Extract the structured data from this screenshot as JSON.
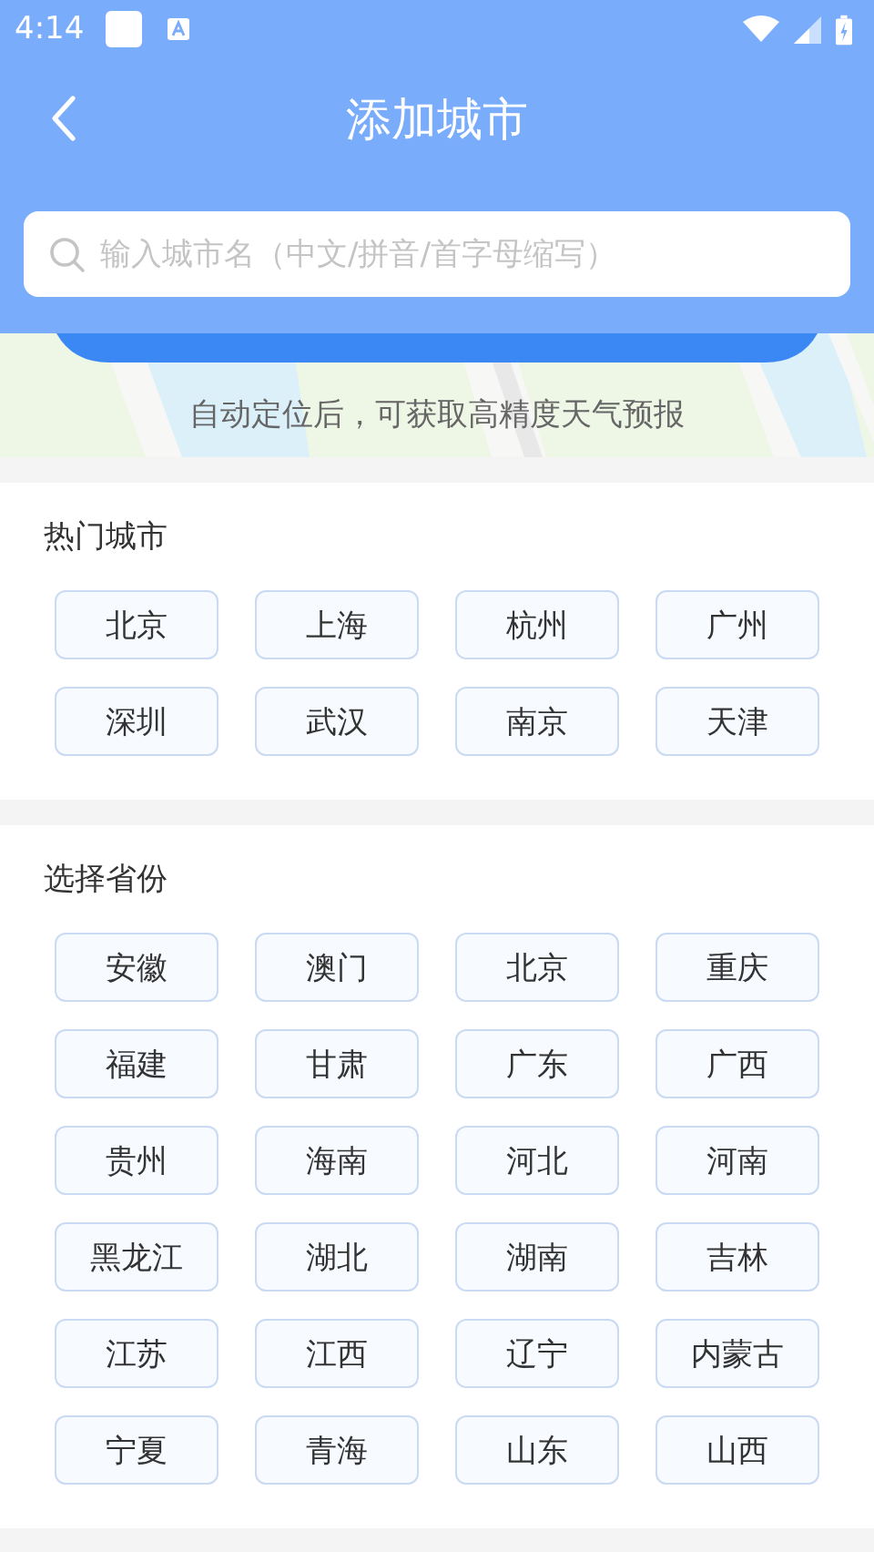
{
  "status_bar": {
    "time": "4:14"
  },
  "header": {
    "title": "添加城市"
  },
  "search": {
    "placeholder": "输入城市名（中文/拼音/首字母缩写）"
  },
  "location_banner": {
    "kind": "picture",
    "hint": "自动定位后，可获取高精度天气预报"
  },
  "hot_cities": {
    "title": "热门城市",
    "items": [
      "北京",
      "上海",
      "杭州",
      "广州",
      "深圳",
      "武汉",
      "南京",
      "天津"
    ]
  },
  "provinces": {
    "title": "选择省份",
    "items": [
      "安徽",
      "澳门",
      "北京",
      "重庆",
      "福建",
      "甘肃",
      "广东",
      "广西",
      "贵州",
      "海南",
      "河北",
      "河南",
      "黑龙江",
      "湖北",
      "湖南",
      "吉林",
      "江苏",
      "江西",
      "辽宁",
      "内蒙古",
      "宁夏",
      "青海",
      "山东",
      "山西"
    ]
  }
}
